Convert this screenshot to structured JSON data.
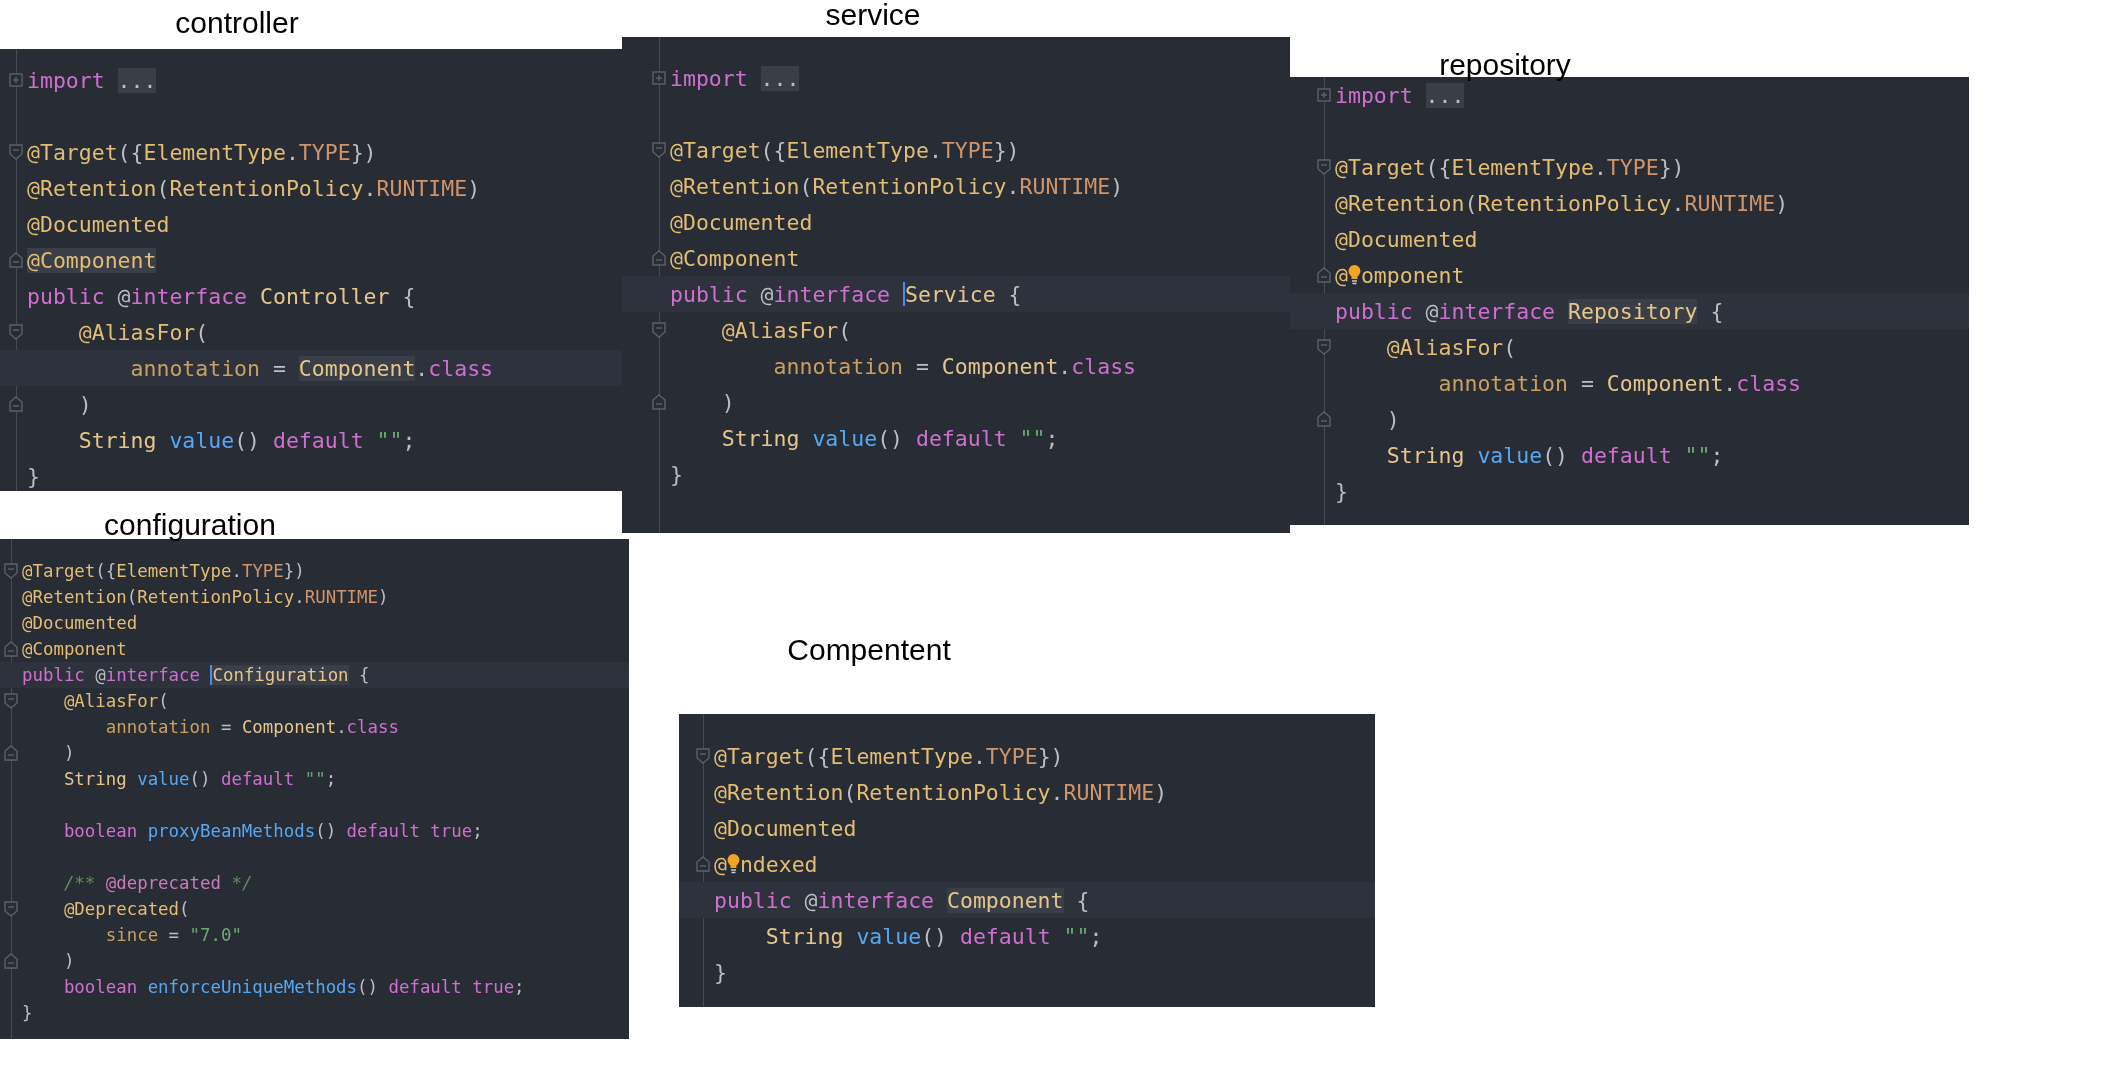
{
  "panels": [
    {
      "label": "controller",
      "lines": [
        {
          "kind": "code",
          "fold": {
            "kind": "expand"
          },
          "tokens": [
            {
              "text": "import ",
              "kind": "kw"
            },
            {
              "text": "...",
              "kind": "punct",
              "highlighted": true
            }
          ]
        },
        {
          "kind": "blank"
        },
        {
          "kind": "code",
          "fold": {
            "kind": "start"
          },
          "tokens": [
            {
              "text": "@Target",
              "kind": "ann"
            },
            {
              "text": "({",
              "kind": "punct"
            },
            {
              "text": "ElementType",
              "kind": "ann"
            },
            {
              "text": ".",
              "kind": "punct"
            },
            {
              "text": "TYPE",
              "kind": "const"
            },
            {
              "text": "})",
              "kind": "punct"
            }
          ]
        },
        {
          "kind": "code",
          "tokens": [
            {
              "text": "@Retention",
              "kind": "ann"
            },
            {
              "text": "(",
              "kind": "punct"
            },
            {
              "text": "RetentionPolicy",
              "kind": "ann"
            },
            {
              "text": ".",
              "kind": "punct"
            },
            {
              "text": "RUNTIME",
              "kind": "const"
            },
            {
              "text": ")",
              "kind": "punct"
            }
          ]
        },
        {
          "kind": "code",
          "tokens": [
            {
              "text": "@Documented",
              "kind": "ann"
            }
          ]
        },
        {
          "kind": "code",
          "fold": {
            "kind": "end"
          },
          "tokens": [
            {
              "text": "@Component",
              "kind": "ann",
              "highlighted": true
            }
          ]
        },
        {
          "kind": "code",
          "tokens": [
            {
              "text": "public ",
              "kind": "kw"
            },
            {
              "text": "@",
              "kind": "punct"
            },
            {
              "text": "interface ",
              "kind": "kw"
            },
            {
              "text": "Controller",
              "kind": "cls"
            },
            {
              "text": " {",
              "kind": "punct"
            }
          ]
        },
        {
          "kind": "code",
          "fold": {
            "kind": "start"
          },
          "tokens": [
            {
              "text": "    @AliasFor",
              "kind": "ann"
            },
            {
              "text": "(",
              "kind": "punct"
            }
          ]
        },
        {
          "kind": "code",
          "current": true,
          "tokens": [
            {
              "text": "        annotation",
              "kind": "param"
            },
            {
              "text": " = ",
              "kind": "punct"
            },
            {
              "text": "Component",
              "kind": "cls",
              "highlighted": true
            },
            {
              "text": ".",
              "kind": "punct"
            },
            {
              "text": "class",
              "kind": "kw"
            }
          ]
        },
        {
          "kind": "code",
          "fold": {
            "kind": "end"
          },
          "tokens": [
            {
              "text": "    )",
              "kind": "punct"
            }
          ]
        },
        {
          "kind": "code",
          "tokens": [
            {
              "text": "    String ",
              "kind": "cls"
            },
            {
              "text": "value",
              "kind": "method"
            },
            {
              "text": "() ",
              "kind": "punct"
            },
            {
              "text": "default ",
              "kind": "kw"
            },
            {
              "text": "\"\"",
              "kind": "str"
            },
            {
              "text": ";",
              "kind": "punct"
            }
          ]
        },
        {
          "kind": "code",
          "tokens": [
            {
              "text": "}",
              "kind": "punct"
            }
          ]
        }
      ]
    },
    {
      "label": "service",
      "lines": [
        {
          "kind": "code",
          "fold": {
            "kind": "expand"
          },
          "tokens": [
            {
              "text": "import ",
              "kind": "kw"
            },
            {
              "text": "...",
              "kind": "punct",
              "highlighted": true
            }
          ]
        },
        {
          "kind": "blank"
        },
        {
          "kind": "code",
          "fold": {
            "kind": "start"
          },
          "tokens": [
            {
              "text": "@Target",
              "kind": "ann"
            },
            {
              "text": "({",
              "kind": "punct"
            },
            {
              "text": "ElementType",
              "kind": "ann"
            },
            {
              "text": ".",
              "kind": "punct"
            },
            {
              "text": "TYPE",
              "kind": "const"
            },
            {
              "text": "})",
              "kind": "punct"
            }
          ]
        },
        {
          "kind": "code",
          "tokens": [
            {
              "text": "@Retention",
              "kind": "ann"
            },
            {
              "text": "(",
              "kind": "punct"
            },
            {
              "text": "RetentionPolicy",
              "kind": "ann"
            },
            {
              "text": ".",
              "kind": "punct"
            },
            {
              "text": "RUNTIME",
              "kind": "const"
            },
            {
              "text": ")",
              "kind": "punct"
            }
          ]
        },
        {
          "kind": "code",
          "tokens": [
            {
              "text": "@Documented",
              "kind": "ann"
            }
          ]
        },
        {
          "kind": "code",
          "fold": {
            "kind": "end"
          },
          "tokens": [
            {
              "text": "@Component",
              "kind": "ann"
            }
          ]
        },
        {
          "kind": "code",
          "current": true,
          "tokens": [
            {
              "text": "public ",
              "kind": "kw"
            },
            {
              "text": "@",
              "kind": "punct"
            },
            {
              "text": "interface ",
              "kind": "kw"
            },
            {
              "text": "Service",
              "kind": "cls",
              "caret": true
            },
            {
              "text": " {",
              "kind": "punct"
            }
          ]
        },
        {
          "kind": "code",
          "fold": {
            "kind": "start"
          },
          "tokens": [
            {
              "text": "    @AliasFor",
              "kind": "ann"
            },
            {
              "text": "(",
              "kind": "punct"
            }
          ]
        },
        {
          "kind": "code",
          "tokens": [
            {
              "text": "        annotation",
              "kind": "param"
            },
            {
              "text": " = ",
              "kind": "punct"
            },
            {
              "text": "Component",
              "kind": "cls"
            },
            {
              "text": ".",
              "kind": "punct"
            },
            {
              "text": "class",
              "kind": "kw"
            }
          ]
        },
        {
          "kind": "code",
          "fold": {
            "kind": "end"
          },
          "tokens": [
            {
              "text": "    )",
              "kind": "punct"
            }
          ]
        },
        {
          "kind": "code",
          "tokens": [
            {
              "text": "    String ",
              "kind": "cls"
            },
            {
              "text": "value",
              "kind": "method"
            },
            {
              "text": "() ",
              "kind": "punct"
            },
            {
              "text": "default ",
              "kind": "kw"
            },
            {
              "text": "\"\"",
              "kind": "str"
            },
            {
              "text": ";",
              "kind": "punct"
            }
          ]
        },
        {
          "kind": "code",
          "tokens": [
            {
              "text": "}",
              "kind": "punct"
            }
          ]
        }
      ]
    },
    {
      "label": "repository",
      "lines": [
        {
          "kind": "code",
          "fold": {
            "kind": "expand"
          },
          "tokens": [
            {
              "text": "import ",
              "kind": "kw"
            },
            {
              "text": "...",
              "kind": "punct",
              "highlighted": true
            }
          ]
        },
        {
          "kind": "blank"
        },
        {
          "kind": "code",
          "fold": {
            "kind": "start"
          },
          "tokens": [
            {
              "text": "@Target",
              "kind": "ann"
            },
            {
              "text": "({",
              "kind": "punct"
            },
            {
              "text": "ElementType",
              "kind": "ann"
            },
            {
              "text": ".",
              "kind": "punct"
            },
            {
              "text": "TYPE",
              "kind": "const"
            },
            {
              "text": "})",
              "kind": "punct"
            }
          ]
        },
        {
          "kind": "code",
          "tokens": [
            {
              "text": "@Retention",
              "kind": "ann"
            },
            {
              "text": "(",
              "kind": "punct"
            },
            {
              "text": "RetentionPolicy",
              "kind": "ann"
            },
            {
              "text": ".",
              "kind": "punct"
            },
            {
              "text": "RUNTIME",
              "kind": "const"
            },
            {
              "text": ")",
              "kind": "punct"
            }
          ]
        },
        {
          "kind": "code",
          "tokens": [
            {
              "text": "@Documented",
              "kind": "ann"
            }
          ]
        },
        {
          "kind": "code",
          "fold": {
            "kind": "end"
          },
          "bulb": true,
          "tokens": [
            {
              "text": "@",
              "kind": "ann"
            },
            {
              "text": "omponent",
              "kind": "ann"
            }
          ]
        },
        {
          "kind": "code",
          "current": true,
          "tokens": [
            {
              "text": "public ",
              "kind": "kw"
            },
            {
              "text": "@",
              "kind": "punct"
            },
            {
              "text": "interface ",
              "kind": "kw"
            },
            {
              "text": "Repository",
              "kind": "cls",
              "highlighted": true
            },
            {
              "text": " {",
              "kind": "punct"
            }
          ]
        },
        {
          "kind": "code",
          "fold": {
            "kind": "start"
          },
          "tokens": [
            {
              "text": "    @AliasFor",
              "kind": "ann"
            },
            {
              "text": "(",
              "kind": "punct"
            }
          ]
        },
        {
          "kind": "code",
          "tokens": [
            {
              "text": "        annotation",
              "kind": "param"
            },
            {
              "text": " = ",
              "kind": "punct"
            },
            {
              "text": "Component",
              "kind": "cls"
            },
            {
              "text": ".",
              "kind": "punct"
            },
            {
              "text": "class",
              "kind": "kw"
            }
          ]
        },
        {
          "kind": "code",
          "fold": {
            "kind": "end"
          },
          "tokens": [
            {
              "text": "    )",
              "kind": "punct"
            }
          ]
        },
        {
          "kind": "code",
          "tokens": [
            {
              "text": "    String ",
              "kind": "cls"
            },
            {
              "text": "value",
              "kind": "method"
            },
            {
              "text": "() ",
              "kind": "punct"
            },
            {
              "text": "default ",
              "kind": "kw"
            },
            {
              "text": "\"\"",
              "kind": "str"
            },
            {
              "text": ";",
              "kind": "punct"
            }
          ]
        },
        {
          "kind": "code",
          "tokens": [
            {
              "text": "}",
              "kind": "punct"
            }
          ]
        }
      ]
    },
    {
      "label": "configuration",
      "lines": [
        {
          "kind": "code",
          "fold": {
            "kind": "start"
          },
          "tokens": [
            {
              "text": "@Target",
              "kind": "ann"
            },
            {
              "text": "({",
              "kind": "punct"
            },
            {
              "text": "ElementType",
              "kind": "ann"
            },
            {
              "text": ".",
              "kind": "punct"
            },
            {
              "text": "TYPE",
              "kind": "const"
            },
            {
              "text": "})",
              "kind": "punct"
            }
          ]
        },
        {
          "kind": "code",
          "tokens": [
            {
              "text": "@Retention",
              "kind": "ann"
            },
            {
              "text": "(",
              "kind": "punct"
            },
            {
              "text": "RetentionPolicy",
              "kind": "ann"
            },
            {
              "text": ".",
              "kind": "punct"
            },
            {
              "text": "RUNTIME",
              "kind": "const"
            },
            {
              "text": ")",
              "kind": "punct"
            }
          ]
        },
        {
          "kind": "code",
          "tokens": [
            {
              "text": "@Documented",
              "kind": "ann"
            }
          ]
        },
        {
          "kind": "code",
          "fold": {
            "kind": "end"
          },
          "tokens": [
            {
              "text": "@Component",
              "kind": "ann"
            }
          ]
        },
        {
          "kind": "code",
          "current": true,
          "tokens": [
            {
              "text": "public ",
              "kind": "kw"
            },
            {
              "text": "@",
              "kind": "punct"
            },
            {
              "text": "interface ",
              "kind": "kw"
            },
            {
              "text": "Configuration",
              "kind": "cls",
              "caret": true,
              "highlighted": true
            },
            {
              "text": " {",
              "kind": "punct"
            }
          ]
        },
        {
          "kind": "code",
          "fold": {
            "kind": "start"
          },
          "tokens": [
            {
              "text": "    @AliasFor",
              "kind": "ann"
            },
            {
              "text": "(",
              "kind": "punct"
            }
          ]
        },
        {
          "kind": "code",
          "tokens": [
            {
              "text": "        annotation",
              "kind": "param"
            },
            {
              "text": " = ",
              "kind": "punct"
            },
            {
              "text": "Component",
              "kind": "cls"
            },
            {
              "text": ".",
              "kind": "punct"
            },
            {
              "text": "class",
              "kind": "kw"
            }
          ]
        },
        {
          "kind": "code",
          "fold": {
            "kind": "end"
          },
          "tokens": [
            {
              "text": "    )",
              "kind": "punct"
            }
          ]
        },
        {
          "kind": "code",
          "tokens": [
            {
              "text": "    String ",
              "kind": "cls"
            },
            {
              "text": "value",
              "kind": "method"
            },
            {
              "text": "() ",
              "kind": "punct"
            },
            {
              "text": "default ",
              "kind": "kw"
            },
            {
              "text": "\"\"",
              "kind": "str"
            },
            {
              "text": ";",
              "kind": "punct"
            }
          ]
        },
        {
          "kind": "blank"
        },
        {
          "kind": "code",
          "tokens": [
            {
              "text": "    boolean ",
              "kind": "kw"
            },
            {
              "text": "proxyBeanMethods",
              "kind": "method"
            },
            {
              "text": "() ",
              "kind": "punct"
            },
            {
              "text": "default true",
              "kind": "kw"
            },
            {
              "text": ";",
              "kind": "punct"
            }
          ]
        },
        {
          "kind": "blank"
        },
        {
          "kind": "code",
          "tokens": [
            {
              "text": "    /** ",
              "kind": "comment"
            },
            {
              "text": "@deprecated",
              "kind": "doctag"
            },
            {
              "text": " */",
              "kind": "comment"
            }
          ]
        },
        {
          "kind": "code",
          "fold": {
            "kind": "start"
          },
          "tokens": [
            {
              "text": "    @Deprecated",
              "kind": "ann"
            },
            {
              "text": "(",
              "kind": "punct"
            }
          ]
        },
        {
          "kind": "code",
          "tokens": [
            {
              "text": "        since",
              "kind": "param"
            },
            {
              "text": " = ",
              "kind": "punct"
            },
            {
              "text": "\"7.0\"",
              "kind": "str"
            }
          ]
        },
        {
          "kind": "code",
          "fold": {
            "kind": "end"
          },
          "tokens": [
            {
              "text": "    )",
              "kind": "punct"
            }
          ]
        },
        {
          "kind": "code",
          "tokens": [
            {
              "text": "    boolean ",
              "kind": "kw"
            },
            {
              "text": "enforceUniqueMethods",
              "kind": "method"
            },
            {
              "text": "() ",
              "kind": "punct"
            },
            {
              "text": "default true",
              "kind": "kw"
            },
            {
              "text": ";",
              "kind": "punct"
            }
          ]
        },
        {
          "kind": "code",
          "tokens": [
            {
              "text": "}",
              "kind": "punct"
            }
          ]
        }
      ]
    },
    {
      "label": "Compentent",
      "lines": [
        {
          "kind": "code",
          "fold": {
            "kind": "start"
          },
          "tokens": [
            {
              "text": "@Target",
              "kind": "ann"
            },
            {
              "text": "({",
              "kind": "punct"
            },
            {
              "text": "ElementType",
              "kind": "ann"
            },
            {
              "text": ".",
              "kind": "punct"
            },
            {
              "text": "TYPE",
              "kind": "const"
            },
            {
              "text": "})",
              "kind": "punct"
            }
          ]
        },
        {
          "kind": "code",
          "tokens": [
            {
              "text": "@Retention",
              "kind": "ann"
            },
            {
              "text": "(",
              "kind": "punct"
            },
            {
              "text": "RetentionPolicy",
              "kind": "ann"
            },
            {
              "text": ".",
              "kind": "punct"
            },
            {
              "text": "RUNTIME",
              "kind": "const"
            },
            {
              "text": ")",
              "kind": "punct"
            }
          ]
        },
        {
          "kind": "code",
          "tokens": [
            {
              "text": "@Documented",
              "kind": "ann"
            }
          ]
        },
        {
          "kind": "code",
          "fold": {
            "kind": "end"
          },
          "bulb": true,
          "tokens": [
            {
              "text": "@",
              "kind": "ann"
            },
            {
              "text": "ndexed",
              "kind": "ann"
            }
          ]
        },
        {
          "kind": "code",
          "current": true,
          "tokens": [
            {
              "text": "public ",
              "kind": "kw"
            },
            {
              "text": "@",
              "kind": "punct"
            },
            {
              "text": "interface ",
              "kind": "kw"
            },
            {
              "text": "Component",
              "kind": "cls",
              "highlighted": true
            },
            {
              "text": " {",
              "kind": "punct"
            }
          ]
        },
        {
          "kind": "code",
          "tokens": [
            {
              "text": "    String ",
              "kind": "cls"
            },
            {
              "text": "value",
              "kind": "method"
            },
            {
              "text": "() ",
              "kind": "punct"
            },
            {
              "text": "default ",
              "kind": "kw"
            },
            {
              "text": "\"\"",
              "kind": "str"
            },
            {
              "text": ";",
              "kind": "punct"
            }
          ]
        },
        {
          "kind": "code",
          "tokens": [
            {
              "text": "}",
              "kind": "punct"
            }
          ]
        }
      ]
    }
  ]
}
